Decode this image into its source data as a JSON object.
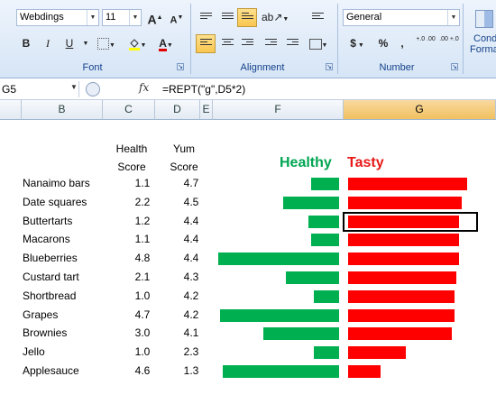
{
  "ribbon": {
    "font": {
      "name": "Webdings",
      "size": "11",
      "grow_label": "A",
      "shrink_label": "A",
      "bold": "B",
      "italic": "I",
      "underline": "U",
      "font_color_label": "A",
      "group_label": "Font"
    },
    "alignment": {
      "group_label": "Alignment"
    },
    "number": {
      "format": "General",
      "currency": "$",
      "percent": "%",
      "comma": ",",
      "inc_decimal": "+.0 .00",
      "dec_decimal": ".00 +.0",
      "group_label": "Number"
    },
    "conditional": {
      "line1": "Cond",
      "line2": "Forma"
    }
  },
  "formula_bar": {
    "name_box": "G5",
    "fx": "fx",
    "formula": "=REPT(\"g\",D5*2)"
  },
  "columns": [
    "B",
    "C",
    "D",
    "E",
    "F",
    "G"
  ],
  "selected_column": "G",
  "sheet": {
    "header_c_line1": "Health",
    "header_c_line2": "Score",
    "header_d_line1": "Yum",
    "header_d_line2": "Score",
    "legend_healthy": "Healthy",
    "legend_tasty": "Tasty",
    "colors": {
      "healthy": "#00b050",
      "tasty": "#ff0000"
    },
    "rows": [
      {
        "name": "Nanaimo bars",
        "health": "1.1",
        "yum": "4.7"
      },
      {
        "name": "Date squares",
        "health": "2.2",
        "yum": "4.5"
      },
      {
        "name": "Buttertarts",
        "health": "1.2",
        "yum": "4.4"
      },
      {
        "name": "Macarons",
        "health": "1.1",
        "yum": "4.4"
      },
      {
        "name": "Blueberries",
        "health": "4.8",
        "yum": "4.4"
      },
      {
        "name": "Custard tart",
        "health": "2.1",
        "yum": "4.3"
      },
      {
        "name": "Shortbread",
        "health": "1.0",
        "yum": "4.2"
      },
      {
        "name": "Grapes",
        "health": "4.7",
        "yum": "4.2"
      },
      {
        "name": "Brownies",
        "health": "3.0",
        "yum": "4.1"
      },
      {
        "name": "Jello",
        "health": "1.0",
        "yum": "2.3"
      },
      {
        "name": "Applesauce",
        "health": "4.6",
        "yum": "1.3"
      }
    ],
    "selected_row_index": 2
  }
}
